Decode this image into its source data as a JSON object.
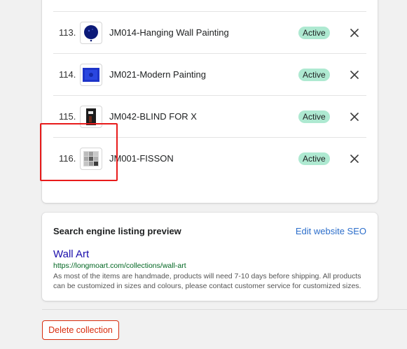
{
  "products": [
    {
      "index": "113.",
      "title": "JM014-Hanging Wall Painting",
      "status": "Active",
      "thumb": "blue-dot-painting"
    },
    {
      "index": "114.",
      "title": "JM021-Modern Painting",
      "status": "Active",
      "thumb": "blue-framed-painting"
    },
    {
      "index": "115.",
      "title": "JM042-BLIND FOR X",
      "status": "Active",
      "thumb": "dark-figure-painting"
    },
    {
      "index": "116.",
      "title": "JM001-FISSON",
      "status": "Active",
      "thumb": "grid-tile-painting"
    }
  ],
  "seo": {
    "heading": "Search engine listing preview",
    "edit_link": "Edit website SEO",
    "title": "Wall Art",
    "url": "https://longmoart.com/collections/wall-art",
    "description": "As most of the items are handmade, products will need 7-10 days before shipping. All products can be customized in sizes and colours, please contact customer service for customized sizes."
  },
  "delete_label": "Delete collection",
  "colors": {
    "badge_bg": "#aee9d1",
    "link": "#2c6ecb",
    "seo_title": "#1a0dab",
    "seo_url": "#006621",
    "danger": "#d82c0d",
    "highlight": "#e81b1b"
  }
}
